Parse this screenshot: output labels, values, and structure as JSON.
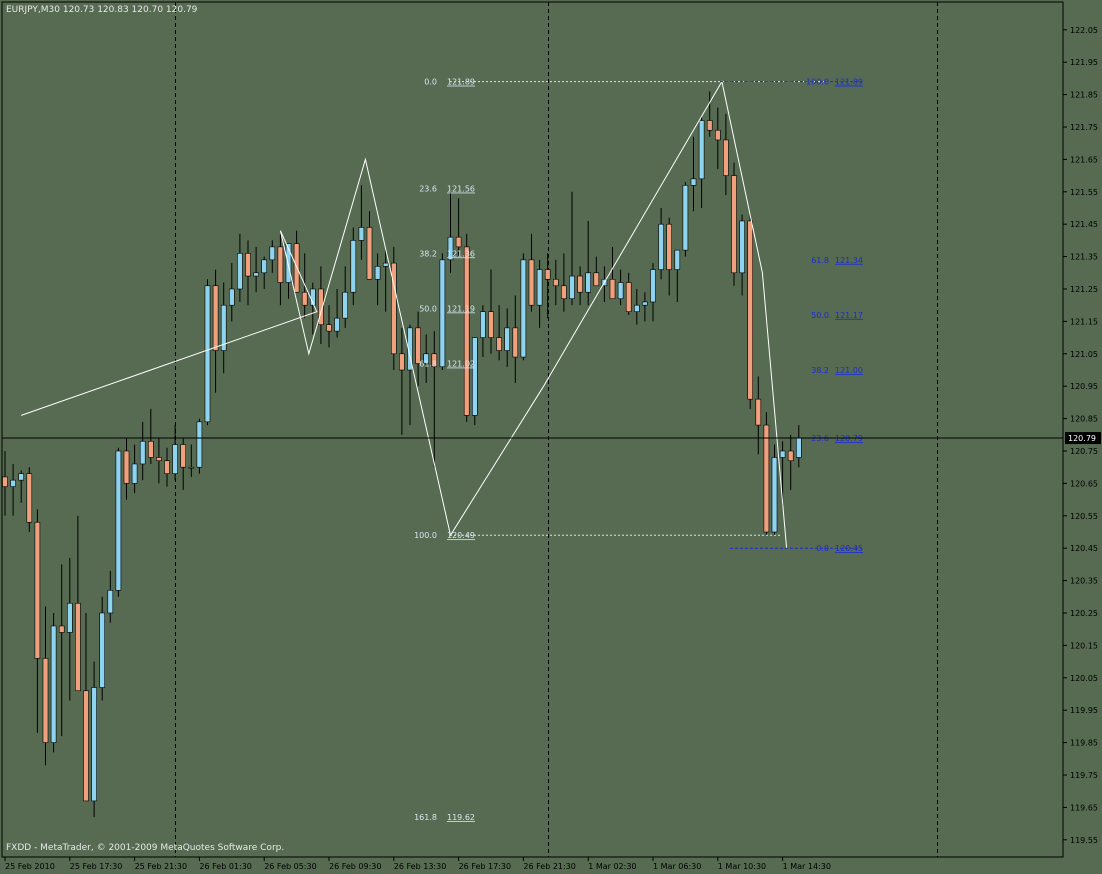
{
  "window": {
    "symbol_line": "EURJPY,M30  120.73 120.83 120.70 120.79",
    "copyright": "FXDD - MetaTrader, © 2001-2009 MetaQuotes Software Corp."
  },
  "colors": {
    "background": "#566b52",
    "bull": "#8ed3f0",
    "bear": "#f0a07c",
    "wick": "#000000",
    "fib_left": "#d6e6f0",
    "fib_right": "#1a2bd8",
    "zigzag": "#ffffff",
    "price_line": "#000000",
    "current_price_bg": "#000000"
  },
  "chart_data": {
    "type": "candlestick",
    "symbol": "EURJPY",
    "timeframe": "M30",
    "last_ohlc": {
      "open": 120.73,
      "high": 120.83,
      "low": 120.7,
      "close": 120.79
    },
    "current_price": "120.79",
    "y_ticks": [
      "122.05",
      "121.95",
      "121.85",
      "121.75",
      "121.65",
      "121.55",
      "121.45",
      "121.35",
      "121.25",
      "121.15",
      "121.05",
      "120.95",
      "120.85",
      "120.75",
      "120.65",
      "120.55",
      "120.45",
      "120.35",
      "120.25",
      "120.15",
      "120.05",
      "119.95",
      "119.85",
      "119.75",
      "119.65",
      "119.55"
    ],
    "x_ticks": [
      {
        "i": 0,
        "label": "25 Feb 2010"
      },
      {
        "i": 8,
        "label": "25 Feb 17:30"
      },
      {
        "i": 16,
        "label": "25 Feb 21:30"
      },
      {
        "i": 24,
        "label": "26 Feb 01:30"
      },
      {
        "i": 32,
        "label": "26 Feb 05:30"
      },
      {
        "i": 40,
        "label": "26 Feb 09:30"
      },
      {
        "i": 48,
        "label": "26 Feb 13:30"
      },
      {
        "i": 56,
        "label": "26 Feb 17:30"
      },
      {
        "i": 64,
        "label": "26 Feb 21:30"
      },
      {
        "i": 72,
        "label": "1 Mar 02:30"
      },
      {
        "i": 80,
        "label": "1 Mar 06:30"
      },
      {
        "i": 88,
        "label": "1 Mar 10:30"
      },
      {
        "i": 96,
        "label": "1 Mar 14:30"
      }
    ],
    "period_separators": [
      21,
      67,
      115
    ],
    "candles": [
      [
        120.67,
        120.75,
        120.55,
        120.64
      ],
      [
        120.64,
        120.71,
        120.55,
        120.66
      ],
      [
        120.66,
        120.69,
        120.59,
        120.68
      ],
      [
        120.68,
        120.7,
        120.5,
        120.53
      ],
      [
        120.53,
        120.57,
        119.88,
        120.11
      ],
      [
        120.11,
        120.27,
        119.78,
        119.85
      ],
      [
        119.85,
        120.25,
        119.82,
        120.21
      ],
      [
        120.21,
        120.4,
        119.87,
        120.19
      ],
      [
        120.19,
        120.42,
        119.98,
        120.28
      ],
      [
        120.28,
        120.55,
        120.21,
        120.01
      ],
      [
        120.01,
        120.25,
        119.69,
        119.67
      ],
      [
        119.67,
        120.1,
        119.62,
        120.02
      ],
      [
        120.02,
        120.3,
        119.98,
        120.25
      ],
      [
        120.25,
        120.38,
        120.22,
        120.32
      ],
      [
        120.32,
        120.76,
        120.3,
        120.75
      ],
      [
        120.75,
        120.79,
        120.6,
        120.65
      ],
      [
        120.65,
        120.77,
        120.62,
        120.71
      ],
      [
        120.71,
        120.84,
        120.66,
        120.78
      ],
      [
        120.78,
        120.88,
        120.71,
        120.73
      ],
      [
        120.73,
        120.79,
        120.65,
        120.72
      ],
      [
        120.72,
        120.76,
        120.64,
        120.68
      ],
      [
        120.68,
        120.83,
        120.66,
        120.77
      ],
      [
        120.77,
        120.79,
        120.63,
        120.7
      ],
      [
        120.7,
        120.77,
        120.67,
        120.7
      ],
      [
        120.7,
        120.85,
        120.68,
        120.84
      ],
      [
        120.84,
        121.28,
        120.83,
        121.26
      ],
      [
        121.26,
        121.31,
        120.93,
        121.06
      ],
      [
        121.06,
        121.27,
        120.99,
        121.2
      ],
      [
        121.2,
        121.33,
        121.15,
        121.25
      ],
      [
        121.25,
        121.42,
        121.21,
        121.36
      ],
      [
        121.36,
        121.4,
        121.2,
        121.29
      ],
      [
        121.29,
        121.38,
        121.24,
        121.3
      ],
      [
        121.3,
        121.35,
        121.25,
        121.34
      ],
      [
        121.34,
        121.4,
        121.3,
        121.38
      ],
      [
        121.38,
        121.42,
        121.2,
        121.27
      ],
      [
        121.27,
        121.37,
        121.22,
        121.39
      ],
      [
        121.39,
        121.43,
        121.3,
        121.24
      ],
      [
        121.24,
        121.36,
        121.16,
        121.2
      ],
      [
        121.2,
        121.27,
        121.11,
        121.25
      ],
      [
        121.25,
        121.32,
        121.08,
        121.14
      ],
      [
        121.14,
        121.2,
        121.07,
        121.12
      ],
      [
        121.12,
        121.25,
        121.1,
        121.16
      ],
      [
        121.16,
        121.32,
        121.13,
        121.24
      ],
      [
        121.24,
        121.44,
        121.2,
        121.4
      ],
      [
        121.4,
        121.57,
        121.34,
        121.44
      ],
      [
        121.44,
        121.49,
        121.35,
        121.28
      ],
      [
        121.28,
        121.36,
        121.2,
        121.32
      ],
      [
        121.32,
        121.37,
        121.18,
        121.33
      ],
      [
        121.33,
        121.38,
        121.0,
        121.05
      ],
      [
        121.05,
        121.13,
        120.8,
        121.0
      ],
      [
        121.0,
        121.14,
        120.83,
        121.13
      ],
      [
        121.13,
        121.18,
        120.95,
        121.02
      ],
      [
        121.02,
        121.11,
        120.96,
        121.05
      ],
      [
        121.05,
        121.12,
        120.7,
        121.01
      ],
      [
        121.01,
        121.36,
        121.0,
        121.34
      ],
      [
        121.34,
        121.55,
        121.3,
        121.41
      ],
      [
        121.41,
        121.53,
        121.35,
        121.38
      ],
      [
        121.38,
        121.42,
        120.84,
        120.86
      ],
      [
        120.86,
        121.08,
        120.83,
        121.1
      ],
      [
        121.1,
        121.2,
        121.04,
        121.18
      ],
      [
        121.18,
        121.31,
        121.05,
        121.1
      ],
      [
        121.1,
        121.2,
        121.03,
        121.06
      ],
      [
        121.06,
        121.19,
        121.01,
        121.13
      ],
      [
        121.13,
        121.23,
        120.96,
        121.04
      ],
      [
        121.04,
        121.36,
        121.03,
        121.34
      ],
      [
        121.34,
        121.42,
        121.18,
        121.2
      ],
      [
        121.2,
        121.34,
        121.13,
        121.31
      ],
      [
        121.31,
        121.36,
        121.16,
        121.28
      ],
      [
        121.28,
        121.34,
        121.2,
        121.26
      ],
      [
        121.26,
        121.36,
        121.18,
        121.22
      ],
      [
        121.22,
        121.55,
        121.2,
        121.29
      ],
      [
        121.29,
        121.32,
        121.2,
        121.24
      ],
      [
        121.24,
        121.46,
        121.2,
        121.3
      ],
      [
        121.3,
        121.35,
        121.26,
        121.26
      ],
      [
        121.26,
        121.32,
        121.21,
        121.28
      ],
      [
        121.28,
        121.38,
        121.22,
        121.22
      ],
      [
        121.22,
        121.31,
        121.2,
        121.27
      ],
      [
        121.27,
        121.3,
        121.17,
        121.18
      ],
      [
        121.18,
        121.25,
        121.14,
        121.2
      ],
      [
        121.2,
        121.24,
        121.15,
        121.21
      ],
      [
        121.21,
        121.33,
        121.15,
        121.31
      ],
      [
        121.31,
        121.5,
        121.28,
        121.45
      ],
      [
        121.45,
        121.47,
        121.23,
        121.31
      ],
      [
        121.31,
        121.37,
        121.21,
        121.37
      ],
      [
        121.37,
        121.58,
        121.35,
        121.57
      ],
      [
        121.57,
        121.72,
        121.49,
        121.59
      ],
      [
        121.59,
        121.78,
        121.5,
        121.77
      ],
      [
        121.77,
        121.86,
        121.72,
        121.74
      ],
      [
        121.74,
        121.81,
        121.62,
        121.71
      ],
      [
        121.71,
        121.79,
        121.54,
        121.6
      ],
      [
        121.6,
        121.64,
        121.26,
        121.3
      ],
      [
        121.3,
        121.48,
        121.23,
        121.46
      ],
      [
        121.46,
        121.48,
        120.88,
        120.91
      ],
      [
        120.91,
        120.98,
        120.74,
        120.83
      ],
      [
        120.83,
        120.87,
        120.49,
        120.5
      ],
      [
        120.5,
        120.77,
        120.49,
        120.73
      ],
      [
        120.73,
        120.78,
        120.58,
        120.75
      ],
      [
        120.75,
        120.8,
        120.63,
        120.72
      ],
      [
        120.73,
        120.83,
        120.7,
        120.79
      ]
    ],
    "zigzag": [
      {
        "x": 2,
        "price": 120.86
      },
      {
        "x": 38.5,
        "price": 121.18
      },
      {
        "x": 34,
        "price": 121.43
      },
      {
        "x": 37.5,
        "price": 121.05
      },
      {
        "x": 44.5,
        "price": 121.65
      },
      {
        "x": 55,
        "price": 120.49
      },
      {
        "x": 66.5,
        "price": 120.95
      },
      {
        "x": 88.5,
        "price": 121.89
      },
      {
        "x": 93.5,
        "price": 121.3
      },
      {
        "x": 96.5,
        "price": 120.45
      }
    ],
    "fib_left": [
      {
        "level": "0.0",
        "price": "121.89",
        "y": 121.89
      },
      {
        "level": "23.6",
        "price": "121.56",
        "y": 121.56
      },
      {
        "level": "38.2",
        "price": "121.36",
        "y": 121.36
      },
      {
        "level": "50.0",
        "price": "121.19",
        "y": 121.19
      },
      {
        "level": "61.8",
        "price": "121.02",
        "y": 121.02
      },
      {
        "level": "100.0",
        "price": "120.49",
        "y": 120.49
      },
      {
        "level": "161.8",
        "price": "119.62",
        "y": 119.62
      }
    ],
    "fib_right": [
      {
        "level": "100.0",
        "price": "121.89",
        "y": 121.89
      },
      {
        "level": "61.8",
        "price": "121.34",
        "y": 121.34
      },
      {
        "level": "50.0",
        "price": "121.17",
        "y": 121.17
      },
      {
        "level": "38.2",
        "price": "121.00",
        "y": 121.0
      },
      {
        "level": "23.6",
        "price": "120.79",
        "y": 120.79
      },
      {
        "level": "0.0",
        "price": "120.45",
        "y": 120.45
      }
    ]
  }
}
